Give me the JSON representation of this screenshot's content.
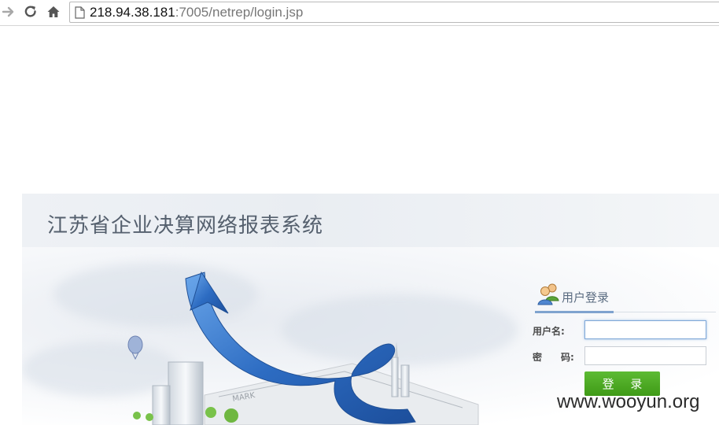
{
  "browser": {
    "url_host": "218.94.38.181",
    "url_path": ":7005/netrep/login.jsp",
    "icons": [
      "forward-arrow-icon",
      "reload-icon",
      "home-icon",
      "page-icon"
    ]
  },
  "page": {
    "title": "江苏省企业决算网络报表系统"
  },
  "login": {
    "header": "用户登录",
    "username_label": "用户名:",
    "password_label": "密　　码:",
    "username_value": "",
    "password_value": "",
    "submit_label": "登 录"
  },
  "watermark": "www.wooyun.org",
  "colors": {
    "title": "#55606e",
    "login_button": "#4caa22",
    "arrow": "#2f6fc4"
  }
}
